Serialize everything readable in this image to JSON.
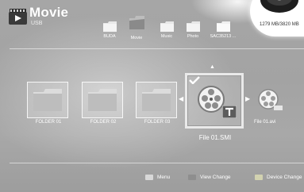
{
  "header": {
    "title": "Movie",
    "subtitle": "USB",
    "storage": "1279 MB/3820 MB"
  },
  "top_folders": [
    {
      "label": "BUDA"
    },
    {
      "label": "Movie"
    },
    {
      "label": "Music"
    },
    {
      "label": "Photo"
    },
    {
      "label": "SAC35213 ..."
    }
  ],
  "items": [
    {
      "label": "FOLDER 01"
    },
    {
      "label": "FOLDER 02"
    },
    {
      "label": "FOLDER 03"
    }
  ],
  "selected_item": {
    "label": "File 01.SMI"
  },
  "next_item": {
    "label": "File 01.avi"
  },
  "footer": [
    {
      "label": "Menu",
      "color": "#d8d8d8"
    },
    {
      "label": "View Change",
      "color": "#a8a8a8"
    },
    {
      "label": "Device Change",
      "color": "#d2d2b0"
    }
  ],
  "icons": {
    "header": "film-icon",
    "folder": "folder-icon",
    "disk": "disk-icon",
    "file": "film-reel-icon",
    "subtitle_file": "subtitle-text-icon",
    "check": "checkmark-icon"
  }
}
